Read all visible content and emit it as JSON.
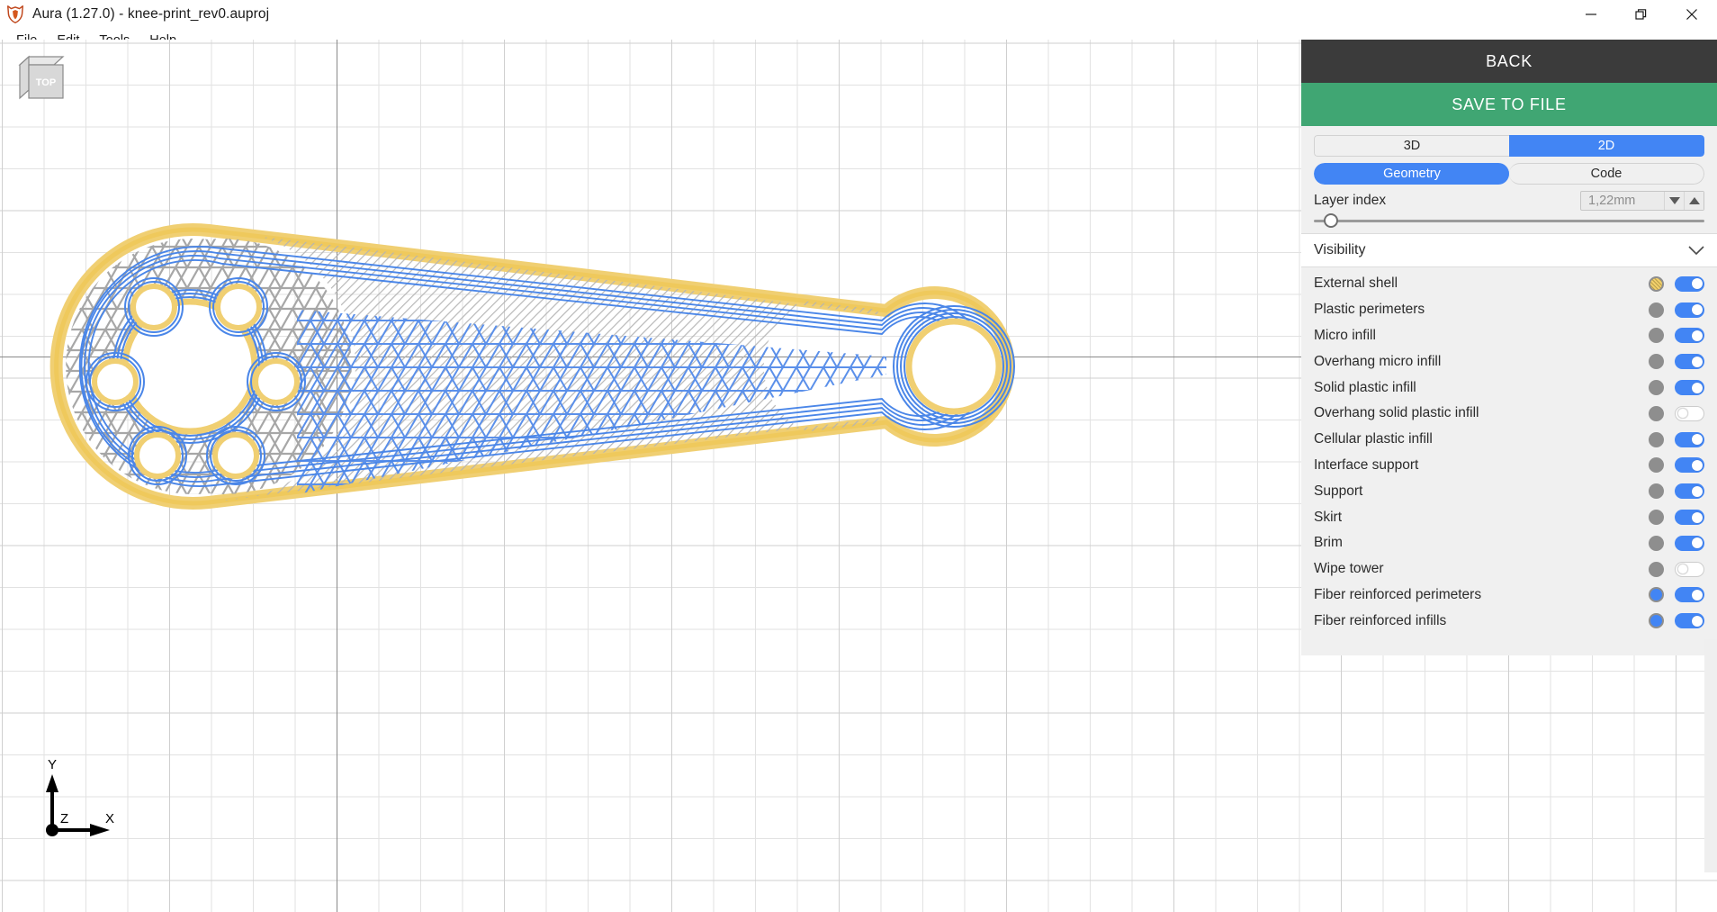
{
  "window": {
    "title": "Aura (1.27.0) - knee-print_rev0.auproj",
    "logo_icon": "aura-fox-logo-icon",
    "controls": [
      {
        "name": "minimize",
        "icon": "minimize-icon"
      },
      {
        "name": "restore",
        "icon": "restore-window-icon"
      },
      {
        "name": "close",
        "icon": "close-icon"
      }
    ]
  },
  "menubar": {
    "items": [
      {
        "label": "File"
      },
      {
        "label": "Edit"
      },
      {
        "label": "Tools"
      },
      {
        "label": "Help"
      }
    ]
  },
  "viewport": {
    "view_cube_label": "TOP",
    "axis_gizmo": {
      "x": "X",
      "y": "Y",
      "z": "Z"
    },
    "colors": {
      "external_shell": "#f2d06b",
      "fiber_reinforced": "#4a86e8",
      "plastic_infill": "#9a9a9a",
      "grid_fine": "#e2e2e2",
      "grid_coarse": "#cfcfcf",
      "axis": "#8a8a8a"
    }
  },
  "panel": {
    "back_label": "BACK",
    "save_label": "SAVE TO FILE",
    "view_mode": {
      "options": [
        "3D",
        "2D"
      ],
      "selected": "2D"
    },
    "content_mode": {
      "options": [
        "Geometry",
        "Code"
      ],
      "selected": "Geometry"
    },
    "layer_index": {
      "label": "Layer index",
      "value": "1,22mm",
      "decrement_icon": "chevron-down-icon",
      "increment_icon": "chevron-up-icon",
      "slider_position_percent": 2.5
    },
    "visibility": {
      "title": "Visibility",
      "collapse_icon": "chevron-down-icon",
      "items": [
        {
          "label": "External shell",
          "swatch": "#f2d06b",
          "swatch_style": "hatched",
          "enabled": true
        },
        {
          "label": "Plastic perimeters",
          "swatch": "#8e8e8e",
          "swatch_style": "solid",
          "enabled": true
        },
        {
          "label": "Micro infill",
          "swatch": "#8e8e8e",
          "swatch_style": "solid",
          "enabled": true
        },
        {
          "label": "Overhang micro infill",
          "swatch": "#8e8e8e",
          "swatch_style": "solid",
          "enabled": true
        },
        {
          "label": "Solid plastic infill",
          "swatch": "#8e8e8e",
          "swatch_style": "solid",
          "enabled": true
        },
        {
          "label": "Overhang solid plastic infill",
          "swatch": "#8e8e8e",
          "swatch_style": "solid",
          "enabled": false
        },
        {
          "label": "Cellular plastic infill",
          "swatch": "#8e8e8e",
          "swatch_style": "solid",
          "enabled": true
        },
        {
          "label": "Interface support",
          "swatch": "#8e8e8e",
          "swatch_style": "solid",
          "enabled": true
        },
        {
          "label": "Support",
          "swatch": "#8e8e8e",
          "swatch_style": "solid",
          "enabled": true
        },
        {
          "label": "Skirt",
          "swatch": "#8e8e8e",
          "swatch_style": "solid",
          "enabled": true
        },
        {
          "label": "Brim",
          "swatch": "#8e8e8e",
          "swatch_style": "solid",
          "enabled": true
        },
        {
          "label": "Wipe tower",
          "swatch": "#8e8e8e",
          "swatch_style": "solid",
          "enabled": false
        },
        {
          "label": "Fiber reinforced perimeters",
          "swatch": "#4285f4",
          "swatch_style": "solid",
          "enabled": true
        },
        {
          "label": "Fiber reinforced infills",
          "swatch": "#4285f4",
          "swatch_style": "solid",
          "enabled": true
        }
      ]
    }
  }
}
